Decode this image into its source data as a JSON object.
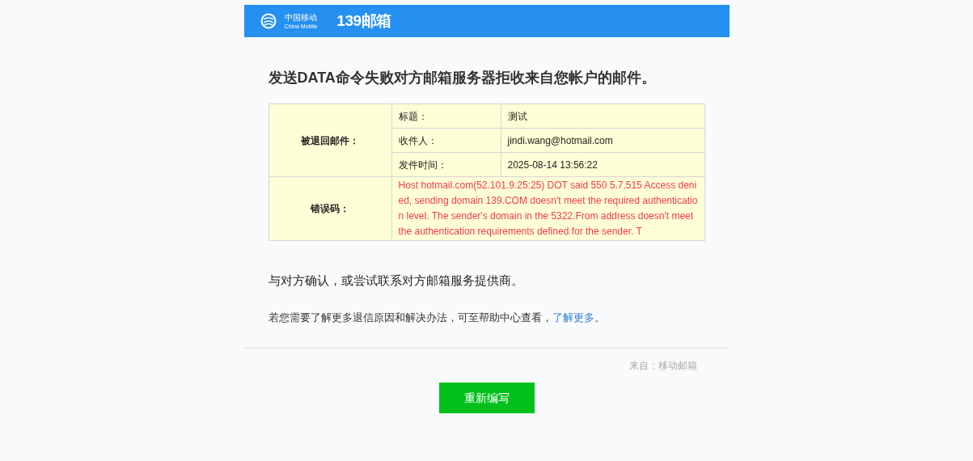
{
  "header": {
    "brand_cn": "中国移动",
    "brand_en": "China Mobile",
    "product": "139邮箱"
  },
  "title": "发送DATA命令失败对方邮箱服务器拒收来自您帐户的邮件。",
  "table": {
    "bounced_label": "被退回邮件：",
    "fields": [
      {
        "label": "标题：",
        "value": "测试"
      },
      {
        "label": "收件人：",
        "value": "jindi.wang@hotmail.com"
      },
      {
        "label": "发件时间：",
        "value": "2025-08-14 13:56:22"
      }
    ],
    "error_label": "错误码：",
    "error_text": "Host hotmail.com(52.101.9.25:25) DOT said 550 5.7.515 Access denied, sending domain 139.COM doesn't meet the required authentication level. The sender's domain in the 5322.From address doesn't meet the authentication requirements defined for the sender. T"
  },
  "advice": "与对方确认，或尝试联系对方邮箱服务提供商。",
  "help": {
    "text": "若您需要了解更多退信原因和解决办法，可至帮助中心查看，",
    "link": "了解更多",
    "end": "。"
  },
  "source": "来自：移动邮箱",
  "button": "重新编写"
}
